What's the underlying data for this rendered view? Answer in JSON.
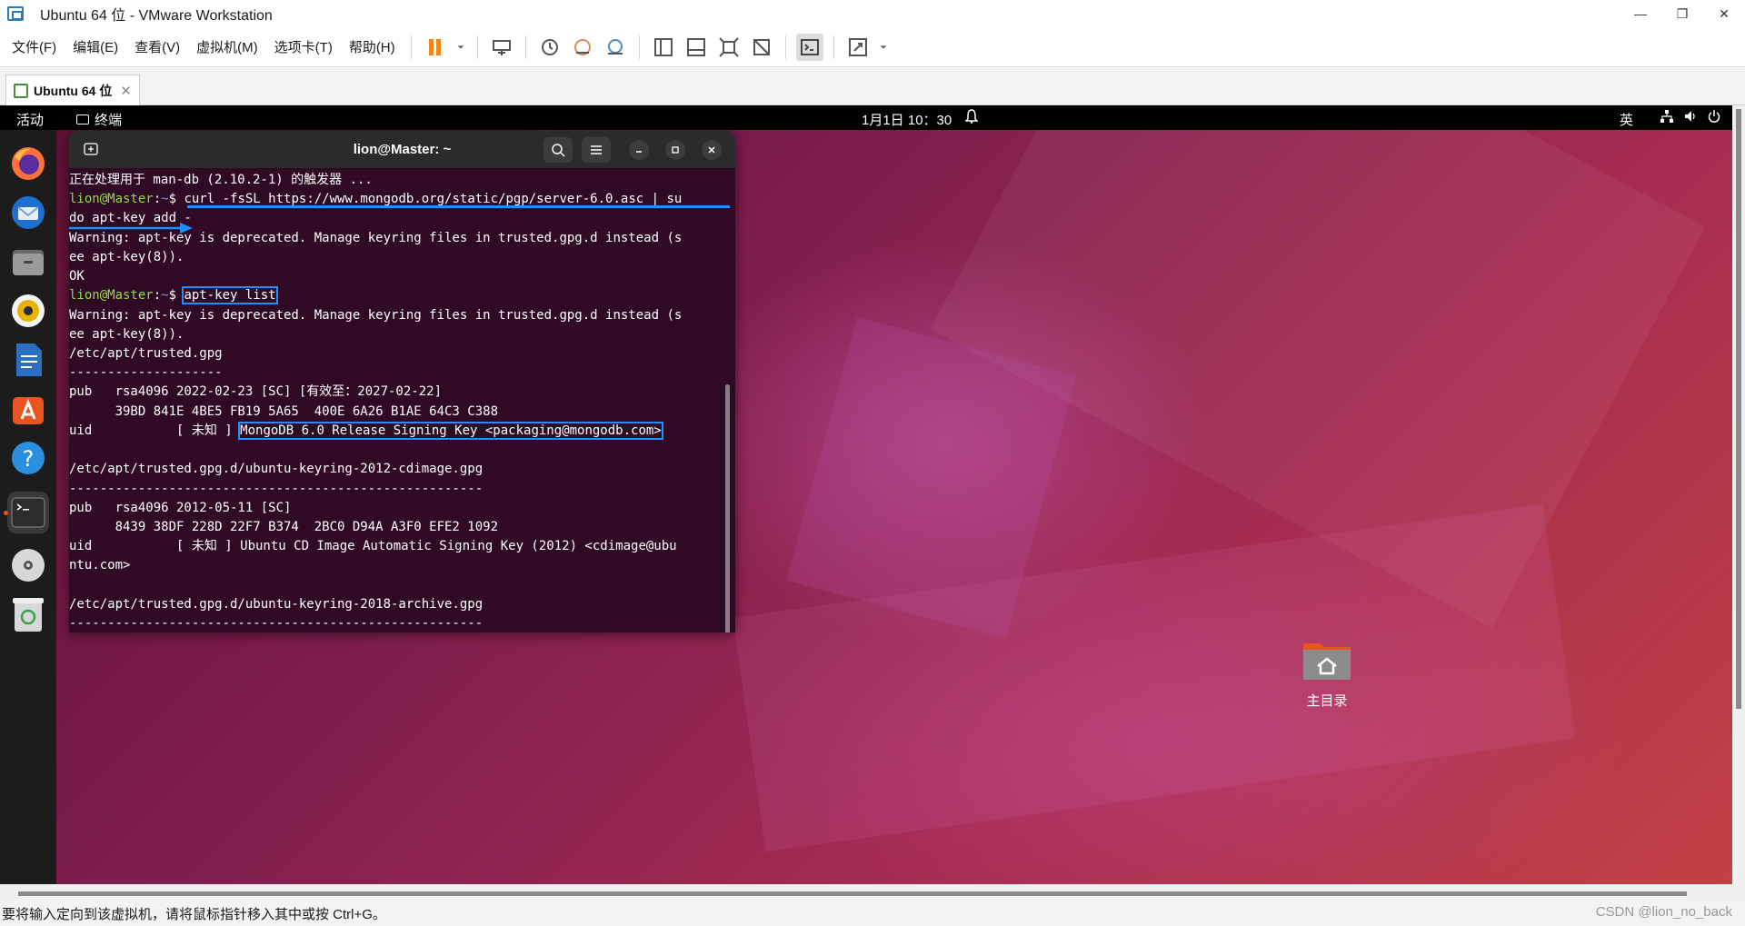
{
  "window": {
    "title": "Ubuntu 64 位 - VMware Workstation"
  },
  "menu": [
    "文件(F)",
    "编辑(E)",
    "查看(V)",
    "虚拟机(M)",
    "选项卡(T)",
    "帮助(H)"
  ],
  "toolbar_icons": [
    "pause-icon",
    "send-ctrl-alt-del-icon",
    "snapshot-icon",
    "revert-snapshot-icon",
    "manage-snapshots-icon",
    "show-library-icon",
    "thumbnail-icon",
    "full-screen-icon",
    "unity-icon",
    "console-view-icon",
    "stretch-icon"
  ],
  "vm_tab": {
    "label": "Ubuntu 64 位",
    "close": "✕"
  },
  "gnome": {
    "activities": "活动",
    "app_name": "终端",
    "clock": "1月1日  10：30",
    "ime": "英"
  },
  "dock_apps": [
    "firefox-icon",
    "thunderbird-icon",
    "files-icon",
    "rhythmbox-icon",
    "libreoffice-writer-icon",
    "app-center-icon",
    "help-icon",
    "terminal-icon",
    "disc-icon",
    "trash-icon"
  ],
  "terminal": {
    "title": "lion@Master: ~",
    "prompt_user": "lion@Master",
    "prompt_sep": ":",
    "prompt_path": "~",
    "prompt_sym": "$ ",
    "lines": {
      "l0": "正在处理用于 man-db (2.10.2-1) 的触发器 ...",
      "l1_cmd": "curl -fsSL https://www.mongodb.org/static/pgp/server-6.0.asc | su",
      "l2": "do apt-key add -",
      "l3": "Warning: apt-key is deprecated. Manage keyring files in trusted.gpg.d instead (s",
      "l4": "ee apt-key(8)).",
      "l5": "OK",
      "l6_cmd": "apt-key list",
      "l7": "Warning: apt-key is deprecated. Manage keyring files in trusted.gpg.d instead (s",
      "l8": "ee apt-key(8)).",
      "l9": "/etc/apt/trusted.gpg",
      "l10": "--------------------",
      "l11": "pub   rsa4096 2022-02-23 [SC] [有效至：2027-02-22]",
      "l12": "      39BD 841E 4BE5 FB19 5A65  400E 6A26 B1AE 64C3 C388",
      "l13_pre": "uid           [ 未知 ] ",
      "l13_key": "MongoDB 6.0 Release Signing Key <packaging@mongodb.com>",
      "l14": "/etc/apt/trusted.gpg.d/ubuntu-keyring-2012-cdimage.gpg",
      "l15": "------------------------------------------------------",
      "l16": "pub   rsa4096 2012-05-11 [SC]",
      "l17": "      8439 38DF 228D 22F7 B374  2BC0 D94A A3F0 EFE2 1092",
      "l18": "uid           [ 未知 ] Ubuntu CD Image Automatic Signing Key (2012) <cdimage@ubu",
      "l19": "ntu.com>",
      "l20": "/etc/apt/trusted.gpg.d/ubuntu-keyring-2018-archive.gpg",
      "l21": "------------------------------------------------------"
    }
  },
  "desktop": {
    "home_label": "主目录"
  },
  "statusbar": {
    "message": "要将输入定向到该虚拟机，请将鼠标指针移入其中或按 Ctrl+G。",
    "watermark": "CSDN @lion_no_back"
  },
  "colors": {
    "terminal_bg": "#300a24",
    "prompt_user": "#8ae234",
    "prompt_path": "#729fcf",
    "annotation": "#1e90ff"
  }
}
